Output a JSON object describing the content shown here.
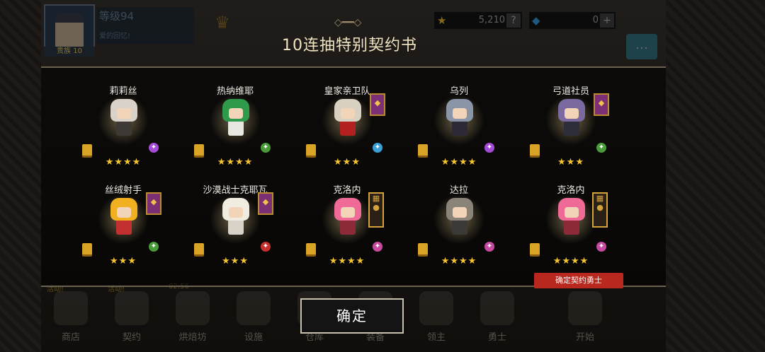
{
  "header": {
    "level": "等级94",
    "subtitle": "爱的回忆!",
    "rank": "贵族 10",
    "resource_gold": "5,210",
    "resource_gem": "0"
  },
  "modal": {
    "title": "10连抽特别契约书",
    "confirm_button": "确定",
    "confirm_tag": "确定契约勇士"
  },
  "heroes": [
    {
      "name": "莉莉丝",
      "stars": "★★★★",
      "element_color": "#a64ad8",
      "hair": "#d8d2c8",
      "body": "#3d3a36"
    },
    {
      "name": "热纳维耶",
      "stars": "★★★★",
      "element_color": "#4a9b3a",
      "hair": "#2e9a4a",
      "body": "#e8e6e0"
    },
    {
      "name": "皇家亲卫队",
      "stars": "★★★",
      "element_color": "#3aa0d8",
      "hair": "#d8d0c0",
      "body": "#b22020"
    },
    {
      "name": "乌列",
      "stars": "★★★★",
      "element_color": "#a64ad8",
      "hair": "#8b95a8",
      "body": "#2d2a35"
    },
    {
      "name": "弓道社员",
      "stars": "★★★",
      "element_color": "#4a9b3a",
      "hair": "#7a6aa0",
      "body": "#2e2e3a"
    },
    {
      "name": "丝绒射手",
      "stars": "★★★",
      "element_color": "#4a9b3a",
      "hair": "#f0b020",
      "body": "#c23030"
    },
    {
      "name": "沙漠战士克耶瓦",
      "stars": "★★★",
      "element_color": "#c83030",
      "hair": "#f0ece0",
      "body": "#d8d2c8"
    },
    {
      "name": "克洛内",
      "stars": "★★★★",
      "element_color": "#c84aa0",
      "hair": "#f06a98",
      "body": "#8c2a3a"
    },
    {
      "name": "达拉",
      "stars": "★★★★",
      "element_color": "#c84aa0",
      "hair": "#8a8478",
      "body": "#3c3a36"
    },
    {
      "name": "克洛内",
      "stars": "★★★★",
      "element_color": "#c84aa0",
      "hair": "#f06a98",
      "body": "#8c2a3a"
    }
  ],
  "nav": [
    {
      "label": "商店",
      "badge": "活动!"
    },
    {
      "label": "契约",
      "badge": "活动!"
    },
    {
      "label": "烘焙坊",
      "badge": "02:56"
    },
    {
      "label": "设施",
      "badge": ""
    },
    {
      "label": "仓库",
      "badge": ""
    },
    {
      "label": "装备",
      "badge": ""
    },
    {
      "label": "领主",
      "badge": ""
    },
    {
      "label": "勇士",
      "badge": ""
    },
    {
      "label": "开始",
      "badge": ""
    }
  ]
}
